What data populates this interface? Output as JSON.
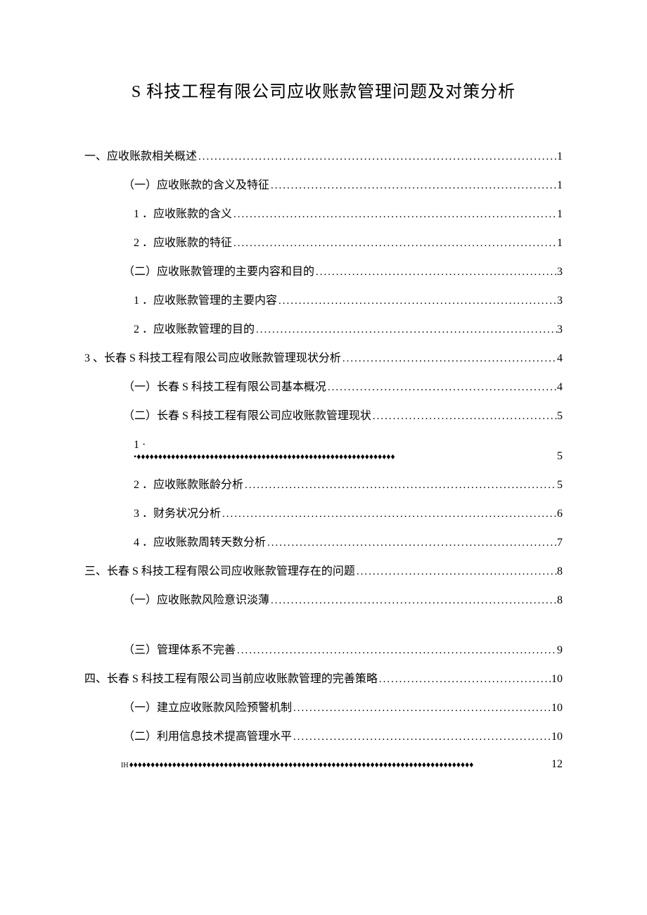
{
  "title": "S 科技工程有限公司应收账款管理问题及对策分析",
  "toc": [
    {
      "kind": "dots",
      "indent": "ind0",
      "label": "一、应收账款相关概述",
      "page": "1"
    },
    {
      "kind": "dots",
      "indent": "ind1",
      "label": "（一）应收账款的含义及特征",
      "page": "1"
    },
    {
      "kind": "dots",
      "indent": "ind2",
      "label": "1 ．应收账款的含义",
      "page": "1"
    },
    {
      "kind": "dots",
      "indent": "ind2",
      "label": "2 ．应收账款的特征 ",
      "page": "1"
    },
    {
      "kind": "dots",
      "indent": "ind1",
      "label": "（二）应收账款管理的主要内容和目的",
      "page": "3"
    },
    {
      "kind": "dots",
      "indent": "ind2",
      "label": "1 ．应收账款管理的主要内容",
      "page": "3"
    },
    {
      "kind": "dots",
      "indent": "ind2",
      "label": "2 ．应收账款管理的目的 ",
      "page": "3"
    },
    {
      "kind": "dots",
      "indent": "ind0",
      "label": "3 、长春 S 科技工程有限公司应收账款管理现状分析",
      "page": "4"
    },
    {
      "kind": "dots",
      "indent": "ind1",
      "label": "（一）长春 S 科技工程有限公司基本概况",
      "page": "4"
    },
    {
      "kind": "dots",
      "indent": "ind1",
      "label": "（二）长春 S 科技工程有限公司应收账款管理现状",
      "page": "5"
    },
    {
      "kind": "label-only",
      "indent": "ind2",
      "label": "1 ·"
    },
    {
      "kind": "diamond-sub",
      "diamondPrefix": "•",
      "page": "5"
    },
    {
      "kind": "dots",
      "indent": "ind2",
      "label": "2 ．应收账款账龄分析 ",
      "page": "5"
    },
    {
      "kind": "dots",
      "indent": "ind2",
      "label": "3 ．财务状况分析 ",
      "page": "6"
    },
    {
      "kind": "dots",
      "indent": "ind2",
      "label": "4 ．应收账款周转天数分析 ",
      "page": "7"
    },
    {
      "kind": "dots",
      "indent": "ind0",
      "label": "三、长春 S 科技工程有限公司应收账款管理存在的问题",
      "page": "8"
    },
    {
      "kind": "dots",
      "indent": "ind1",
      "label": "（一）应收账款风险意识淡薄",
      "page": "8"
    },
    {
      "kind": "gap"
    },
    {
      "kind": "dots",
      "indent": "ind1",
      "label": "（三）管理体系不完善",
      "page": "9"
    },
    {
      "kind": "dots",
      "indent": "ind0",
      "label": "四、长春 S 科技工程有限公司当前应收账款管理的完善策略 ",
      "page": "10"
    },
    {
      "kind": "dots",
      "indent": "ind1",
      "label": "（一）建立应收账款风险预警机制",
      "page": "10"
    },
    {
      "kind": "dots",
      "indent": "ind1",
      "label": "（二）利用信息技术提高管理水平",
      "page": "10"
    },
    {
      "kind": "diamond-bottom",
      "lead": "IH",
      "page": "12"
    }
  ],
  "diamondChar": "♦"
}
